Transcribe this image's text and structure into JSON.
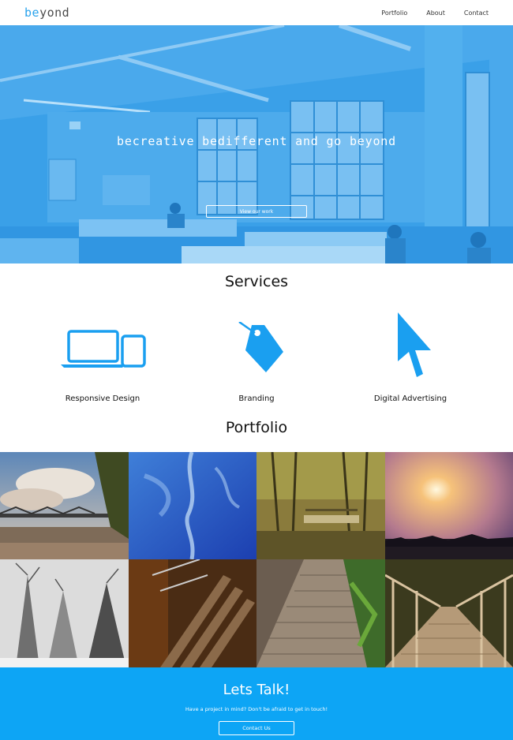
{
  "header": {
    "logo_prefix": "be",
    "logo_suffix": "yond",
    "nav": [
      {
        "label": "Portfolio"
      },
      {
        "label": "About"
      },
      {
        "label": "Contact"
      }
    ]
  },
  "hero": {
    "tagline": "becreative bedifferent and go beyond",
    "button_label": "View our work"
  },
  "services": {
    "title": "Services",
    "items": [
      {
        "label": "Responsive Design",
        "icon": "devices-icon"
      },
      {
        "label": "Branding",
        "icon": "tag-icon"
      },
      {
        "label": "Digital Advertising",
        "icon": "cursor-icon"
      }
    ]
  },
  "portfolio": {
    "title": "Portfolio",
    "tiles": [
      "bridge-over-river-photo",
      "blue-sky-clouds-photo",
      "forest-footbridge-photo",
      "sunset-skyline-photo",
      "snowy-trees-photo",
      "wooden-bench-photo",
      "brick-path-photo",
      "wooden-bridge-photo"
    ]
  },
  "contact": {
    "title": "Lets Talk!",
    "text": "Have a project in mind? Don't be afraid to get in touch!",
    "button_label": "Contact Us"
  },
  "colors": {
    "accent": "#0da5f5",
    "hero_tint": "#3ba2ea"
  }
}
